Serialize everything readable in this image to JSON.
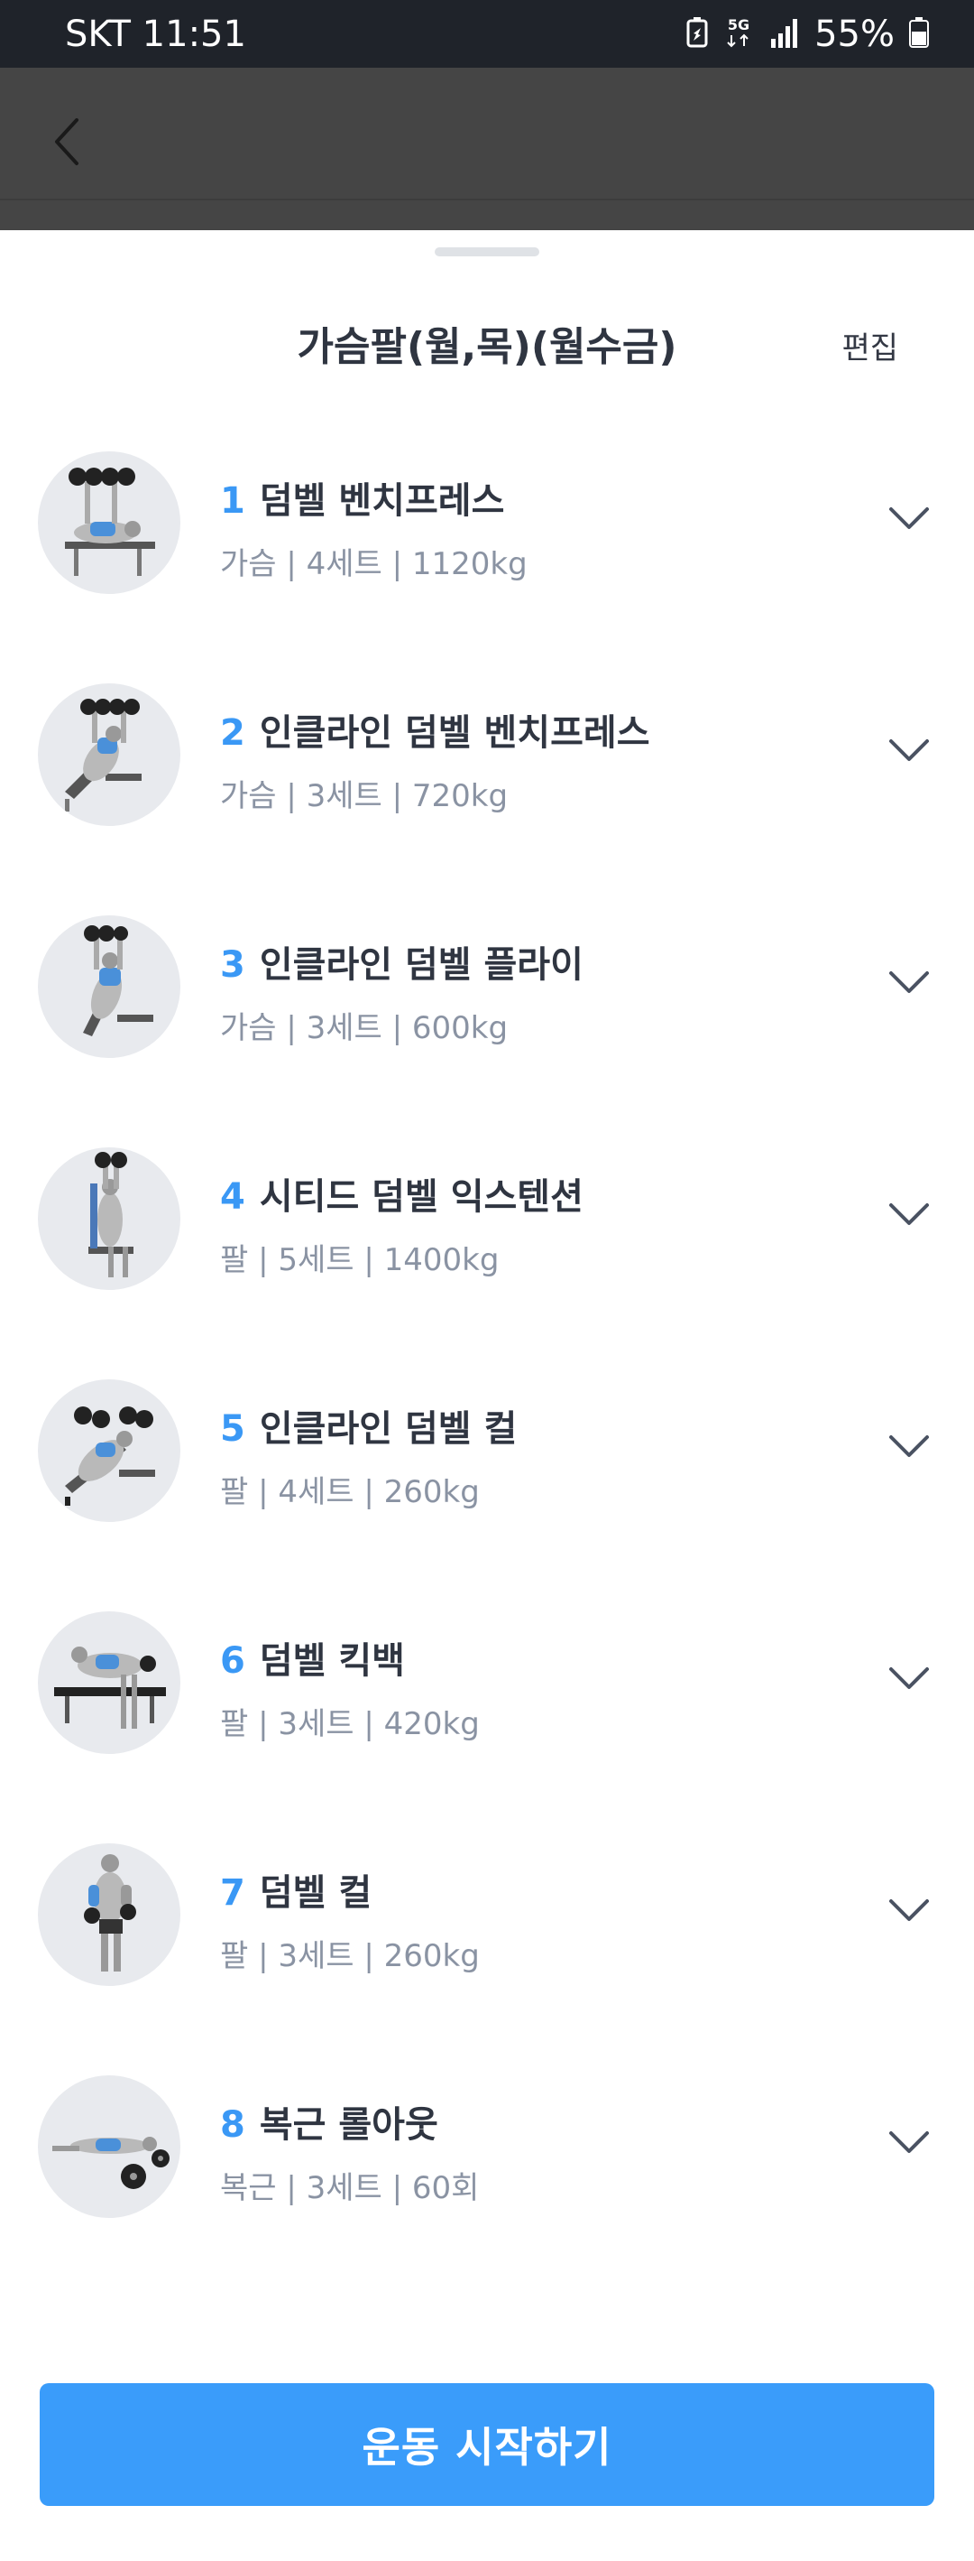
{
  "status_bar": {
    "carrier_time": "SKT 11:51",
    "network": "5G",
    "battery": "55%"
  },
  "header": {
    "title": "가슴팔(월,목)(월수금)",
    "edit_label": "편집"
  },
  "exercises": [
    {
      "number": "1",
      "name": "덤벨 벤치프레스",
      "meta": "가슴 | 4세트 | 1120kg"
    },
    {
      "number": "2",
      "name": "인클라인 덤벨 벤치프레스",
      "meta": "가슴 | 3세트 | 720kg"
    },
    {
      "number": "3",
      "name": "인클라인 덤벨 플라이",
      "meta": "가슴 | 3세트 | 600kg"
    },
    {
      "number": "4",
      "name": "시티드 덤벨 익스텐션",
      "meta": "팔 | 5세트 | 1400kg"
    },
    {
      "number": "5",
      "name": "인클라인 덤벨 컬",
      "meta": "팔 | 4세트 | 260kg"
    },
    {
      "number": "6",
      "name": "덤벨 킥백",
      "meta": "팔 | 3세트 | 420kg"
    },
    {
      "number": "7",
      "name": "덤벨 컬",
      "meta": "팔 | 3세트 | 260kg"
    },
    {
      "number": "8",
      "name": "복근 롤아웃",
      "meta": "복근 | 3세트 | 60회"
    }
  ],
  "start_button_label": "운동 시작하기",
  "colors": {
    "accent": "#3a9cfa",
    "number": "#3a98f5",
    "title_text": "#2f3541",
    "meta_text": "#8a93a3",
    "backdrop": "#454545",
    "status_bar": "#1f232a"
  },
  "icons": {
    "back": "chevron-left-icon",
    "expand": "chevron-down-icon",
    "thumbnail": "exercise-illustration"
  }
}
